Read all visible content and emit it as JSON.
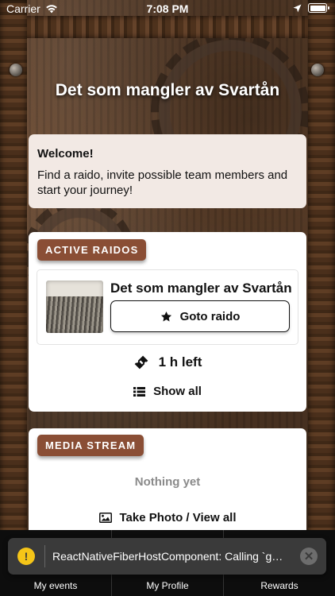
{
  "status_bar": {
    "carrier": "Carrier",
    "time": "7:08 PM"
  },
  "page_title": "Det som mangler av Svartån",
  "welcome": {
    "heading": "Welcome!",
    "body": "Find a raido, invite possible team members and start your journey!"
  },
  "active_raidos": {
    "label": "ACTIVE RAIDOS",
    "item": {
      "name": "Det som mangler av Svartån",
      "button_label": "Goto raido",
      "button_icon": "star-icon"
    },
    "time_left": "1 h left",
    "show_all": "Show all"
  },
  "media_stream": {
    "label": "MEDIA STREAM",
    "empty_text": "Nothing yet",
    "take_photo_label": "Take Photo / View all"
  },
  "toast": {
    "message": "ReactNativeFiberHostComponent: Calling `getNode()` on the ref of an Animated component is no longer necessary."
  },
  "tabs": [
    {
      "label": "My events"
    },
    {
      "label": "My Profile"
    },
    {
      "label": "Rewards"
    }
  ]
}
